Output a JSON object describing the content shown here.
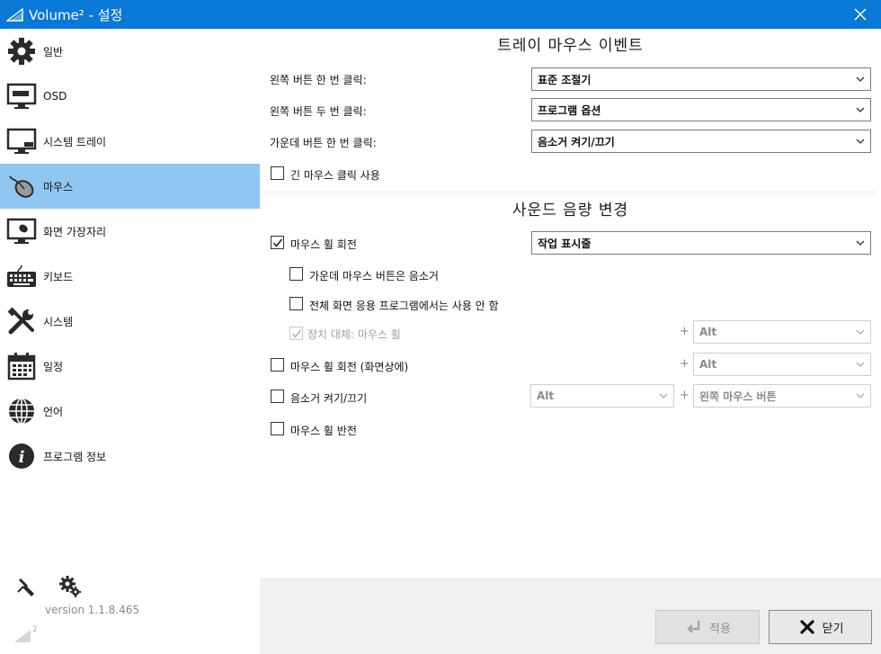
{
  "window": {
    "title": "Volume² - 설정",
    "close_glyph": "✕"
  },
  "sidebar": {
    "items": [
      {
        "label": "일반",
        "icon": "gear-icon"
      },
      {
        "label": "OSD",
        "icon": "monitor-icon"
      },
      {
        "label": "시스템 트레이",
        "icon": "tray-monitor-icon"
      },
      {
        "label": "마우스",
        "icon": "mouse-icon",
        "active": true
      },
      {
        "label": "화면 가장자리",
        "icon": "screen-edge-icon"
      },
      {
        "label": "키보드",
        "icon": "keyboard-icon"
      },
      {
        "label": "시스템",
        "icon": "tools-icon"
      },
      {
        "label": "일정",
        "icon": "calendar-icon"
      },
      {
        "label": "언어",
        "icon": "globe-icon"
      },
      {
        "label": "프로그램 정보",
        "icon": "info-icon"
      }
    ],
    "version": "version 1.1.8.465",
    "logo_sup": "2"
  },
  "tray_events": {
    "title": "트레이 마우스 이벤트",
    "rows": [
      {
        "label": "왼쪽 버튼 한 번 클릭:",
        "value": "표준 조절기"
      },
      {
        "label": "왼쪽 버튼 두 번 클릭:",
        "value": "프로그램 옵션"
      },
      {
        "label": "가운데 버튼 한 번 클릭:",
        "value": "음소거 켜기/끄기"
      }
    ],
    "long_click": {
      "label": "긴 마우스 클릭 사용",
      "checked": false
    }
  },
  "volume_change": {
    "title": "사운드 음량 변경",
    "wheel_rotation": {
      "label": "마우스 휠 회전",
      "checked": true,
      "value": "작업 표시줄"
    },
    "middle_mute": {
      "label": "가운데 마우스 버튼은 음소거",
      "checked": false
    },
    "fullscreen_disable": {
      "label": "전체 화면 응용 프로그램에서는 사용 안 함",
      "checked": false
    },
    "device_replace": {
      "label": "장치 대체: 마우스 휠",
      "checked": true,
      "disabled": true,
      "plus": "+",
      "modifier": "Alt"
    },
    "wheel_on_screen": {
      "label": "마우스 휠 회전 (화면상에)",
      "checked": false,
      "plus": "+",
      "modifier": "Alt"
    },
    "mute_toggle": {
      "label": "음소거 켜기/끄기",
      "checked": false,
      "modifier": "Alt",
      "plus": "+",
      "button": "왼쪽 마우스 버튼"
    },
    "wheel_invert": {
      "label": "마우스 휠 반전",
      "checked": false
    }
  },
  "footer": {
    "apply_label": "적용",
    "close_label": "닫기"
  },
  "colors": {
    "titlebar": "#0a78d7",
    "active_nav": "#90c6f2"
  }
}
